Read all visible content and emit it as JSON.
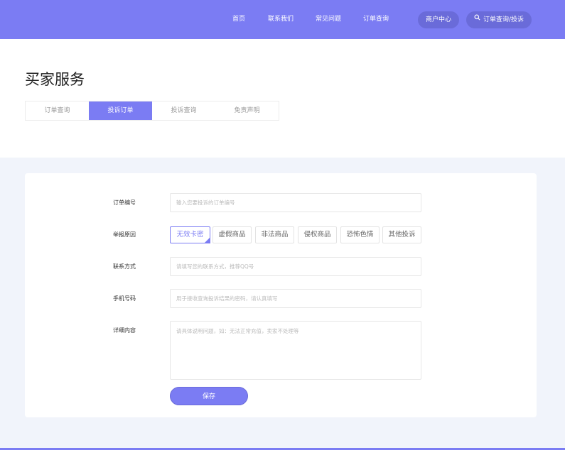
{
  "header": {
    "nav": [
      "首页",
      "联系我们",
      "常见问题",
      "订单查询"
    ],
    "merchant_label": "商户中心",
    "query_label": "订单查询/投诉"
  },
  "page": {
    "title": "买家服务",
    "tabs": [
      "订单查询",
      "投诉订单",
      "投诉查询",
      "免责声明"
    ],
    "active_tab": 1
  },
  "form": {
    "order_no_label": "订单编号",
    "order_no_placeholder": "输入您要投诉的订单编号",
    "reason_label": "举报原因",
    "reasons": [
      "无效卡密",
      "虚假商品",
      "非法商品",
      "侵权商品",
      "恐怖色情",
      "其他投诉"
    ],
    "selected_reason": "无效卡密",
    "contact_label": "联系方式",
    "contact_placeholder": "请填写您的联系方式，推荐QQ号",
    "phone_label": "手机号码",
    "phone_placeholder": "用于接收查询投诉结果的密码，请认真填写",
    "detail_label": "详细内容",
    "detail_placeholder": "请具体说明问题，如：无法正常充值，卖家不处理等",
    "save_label": "保存"
  },
  "colors": {
    "accent": "#7b7cf3",
    "accent_dark": "#6a6bd9",
    "background": "#f1f4fb"
  }
}
